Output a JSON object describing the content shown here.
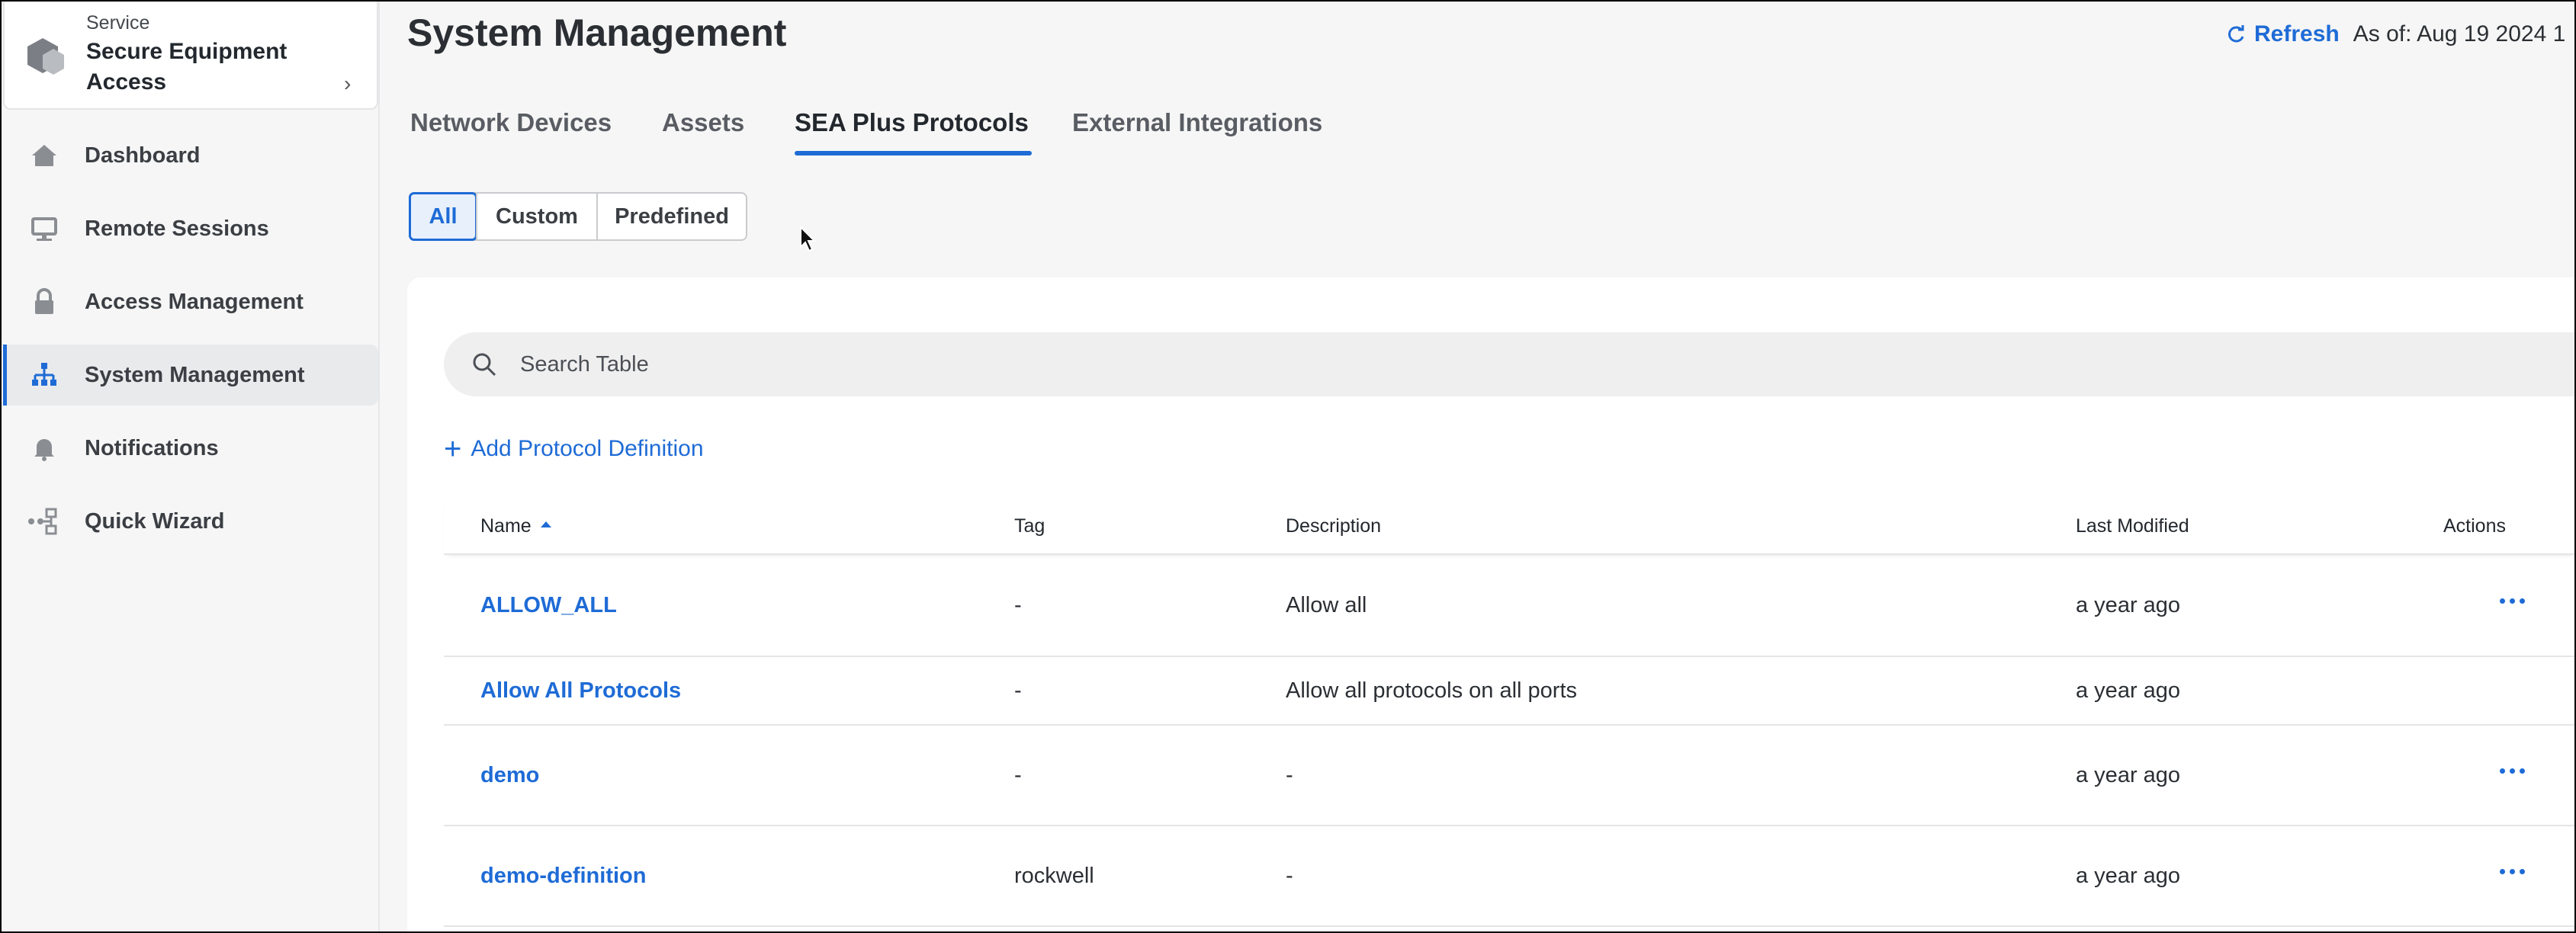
{
  "service": {
    "label": "Service",
    "name": "Secure Equipment Access"
  },
  "sidebar": {
    "items": [
      {
        "label": "Dashboard",
        "icon": "home-icon"
      },
      {
        "label": "Remote Sessions",
        "icon": "monitor-icon"
      },
      {
        "label": "Access Management",
        "icon": "lock-icon"
      },
      {
        "label": "System Management",
        "icon": "network-icon",
        "active": true
      },
      {
        "label": "Notifications",
        "icon": "bell-icon"
      },
      {
        "label": "Quick Wizard",
        "icon": "flow-icon"
      }
    ]
  },
  "header": {
    "title": "System Management",
    "refresh_label": "Refresh",
    "as_of": "As of: Aug 19 2024 1"
  },
  "tabs": [
    {
      "label": "Network Devices"
    },
    {
      "label": "Assets"
    },
    {
      "label": "SEA Plus Protocols",
      "active": true
    },
    {
      "label": "External Integrations"
    }
  ],
  "filter": {
    "options": [
      "All",
      "Custom",
      "Predefined"
    ],
    "selected": "All"
  },
  "search": {
    "placeholder": "Search Table"
  },
  "add_label": "Add Protocol Definition",
  "table": {
    "columns": [
      "Name",
      "Tag",
      "Description",
      "Last Modified",
      "Actions"
    ],
    "sort": {
      "column": "Name",
      "direction": "ascending"
    },
    "rows": [
      {
        "name": "ALLOW_ALL",
        "tag": "-",
        "description": "Allow all",
        "modified": "a year ago",
        "actions": true
      },
      {
        "name": "Allow All Protocols",
        "tag": "-",
        "description": "Allow all protocols on all ports",
        "modified": "a year ago",
        "actions": false
      },
      {
        "name": "demo",
        "tag": "-",
        "description": "-",
        "modified": "a year ago",
        "actions": true
      },
      {
        "name": "demo-definition",
        "tag": "rockwell",
        "description": "-",
        "modified": "a year ago",
        "actions": true
      }
    ]
  },
  "colors": {
    "accent": "#1e6bd6",
    "text": "#23282e",
    "background": "#f6f6f6"
  }
}
